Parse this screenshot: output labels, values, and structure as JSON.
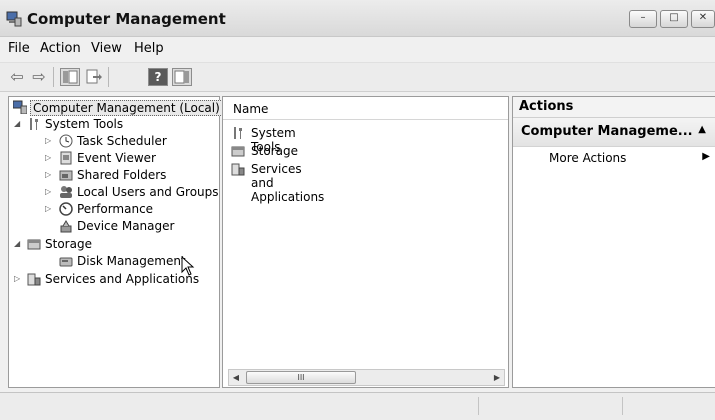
{
  "window": {
    "title": "Computer Management"
  },
  "window_buttons": {
    "minimize": "–",
    "maximize": "□",
    "close": "✕"
  },
  "menu": [
    "File",
    "Action",
    "View",
    "Help"
  ],
  "toolbar": {
    "back": "⇦",
    "forward": "⇨",
    "icons": [
      "show-hide-console-tree-icon",
      "export-list-icon",
      "help-icon",
      "show-hide-action-pane-icon"
    ]
  },
  "tree": {
    "items": [
      {
        "label": "Computer Management (Local)",
        "expander": "",
        "icon": "computer-management-icon",
        "selected": true
      },
      {
        "label": "System Tools",
        "expander": "◢",
        "icon": "system-tools-icon"
      },
      {
        "label": "Task Scheduler",
        "expander": "▷",
        "icon": "task-scheduler-icon"
      },
      {
        "label": "Event Viewer",
        "expander": "▷",
        "icon": "event-viewer-icon"
      },
      {
        "label": "Shared Folders",
        "expander": "▷",
        "icon": "shared-folders-icon"
      },
      {
        "label": "Local Users and Groups",
        "expander": "▷",
        "icon": "users-groups-icon"
      },
      {
        "label": "Performance",
        "expander": "▷",
        "icon": "performance-icon"
      },
      {
        "label": "Device Manager",
        "expander": "",
        "icon": "device-manager-icon"
      },
      {
        "label": "Storage",
        "expander": "◢",
        "icon": "storage-icon"
      },
      {
        "label": "Disk Management",
        "expander": "",
        "icon": "disk-management-icon"
      },
      {
        "label": "Services and Applications",
        "expander": "▷",
        "icon": "services-applications-icon"
      }
    ]
  },
  "list": {
    "column_header": "Name",
    "rows": [
      {
        "label": "System Tools",
        "icon": "system-tools-icon"
      },
      {
        "label": "Storage",
        "icon": "storage-icon"
      },
      {
        "label": "Services and Applications",
        "icon": "services-applications-icon"
      }
    ],
    "scroll_thumb_label": "III",
    "scroll_left": "◀",
    "scroll_right": "▶"
  },
  "actions": {
    "header": "Actions",
    "section_title": "Computer Manageme...",
    "section_caret": "▲",
    "more_actions": "More Actions",
    "more_actions_arrow": "▶"
  }
}
